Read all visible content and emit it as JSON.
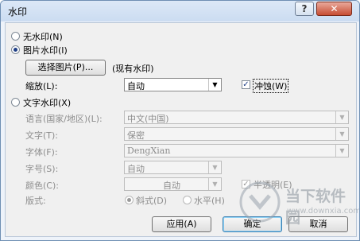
{
  "window": {
    "title": "水印",
    "help_glyph": "?",
    "close_glyph": "✕"
  },
  "options": {
    "none": {
      "label": "无水印(N)"
    },
    "picture": {
      "label": "图片水印(I)"
    },
    "text": {
      "label": "文字水印(X)"
    }
  },
  "picture": {
    "select_button": "选择图片(P)...",
    "current": "(现有水印)",
    "scale_label": "缩放(L):",
    "scale_value": "自动",
    "washout_label": "冲蚀(W)"
  },
  "text": {
    "language_label": "语言(国家/地区)(L):",
    "language_value": "中文(中国)",
    "text_label": "文字(T):",
    "text_value": "保密",
    "font_label": "字体(F):",
    "font_value": "DengXian",
    "size_label": "字号(S):",
    "size_value": "自动",
    "color_label": "颜色(C):",
    "color_value": "自动",
    "semitransparent_label": "半透明(E)",
    "layout_label": "版式:",
    "layout_diagonal": "斜式(D)",
    "layout_horizontal": "水平(H)"
  },
  "buttons": {
    "apply": "应用(A)",
    "ok": "确定",
    "cancel": "取消"
  },
  "overlay": {
    "brand_cn": "当下软件园",
    "brand_url": "www.downxia.com"
  },
  "colors": {
    "title_bar": "#cbdcf1",
    "close_button": "#c74d33",
    "dialog_bg": "#f0f0f0"
  }
}
